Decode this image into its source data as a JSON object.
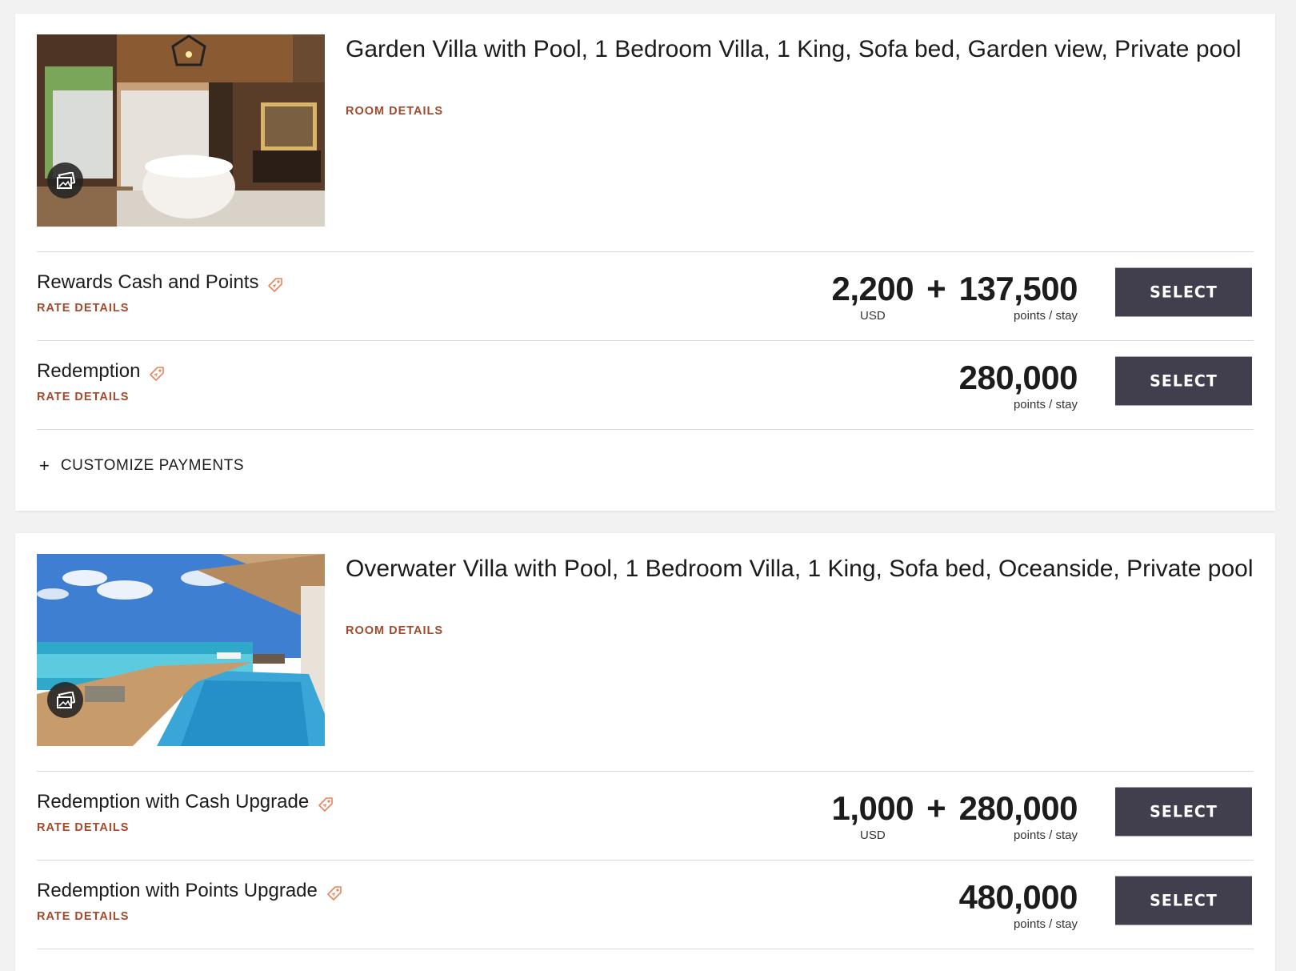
{
  "rooms": [
    {
      "title": "Garden Villa with Pool, 1 Bedroom Villa, 1 King, Sofa bed, Garden view, Private pool",
      "room_details_label": "ROOM DETAILS",
      "image_icon": "photo-gallery-icon",
      "rates": [
        {
          "name": "Rewards Cash and Points",
          "rate_details_label": "RATE DETAILS",
          "cash": "2,200",
          "cash_unit": "USD",
          "plus": "+",
          "points": "137,500",
          "points_unit": "points / stay",
          "select_label": "SELECT"
        },
        {
          "name": "Redemption",
          "rate_details_label": "RATE DETAILS",
          "points": "280,000",
          "points_unit": "points / stay",
          "select_label": "SELECT"
        }
      ],
      "customize": {
        "icon": "+",
        "label": "CUSTOMIZE PAYMENTS"
      }
    },
    {
      "title": "Overwater Villa with Pool, 1 Bedroom Villa, 1 King, Sofa bed, Oceanside, Private pool",
      "room_details_label": "ROOM DETAILS",
      "image_icon": "photo-gallery-icon",
      "rates": [
        {
          "name": "Redemption with Cash Upgrade",
          "rate_details_label": "RATE DETAILS",
          "cash": "1,000",
          "cash_unit": "USD",
          "plus": "+",
          "points": "280,000",
          "points_unit": "points / stay",
          "select_label": "SELECT"
        },
        {
          "name": "Redemption with Points Upgrade",
          "rate_details_label": "RATE DETAILS",
          "points": "480,000",
          "points_unit": "points / stay",
          "select_label": "SELECT"
        }
      ]
    }
  ],
  "colors": {
    "accent_link": "#a4492b",
    "button_bg": "#413e4d",
    "tag_icon": "#e8845c",
    "divider": "#d9d9d9"
  }
}
